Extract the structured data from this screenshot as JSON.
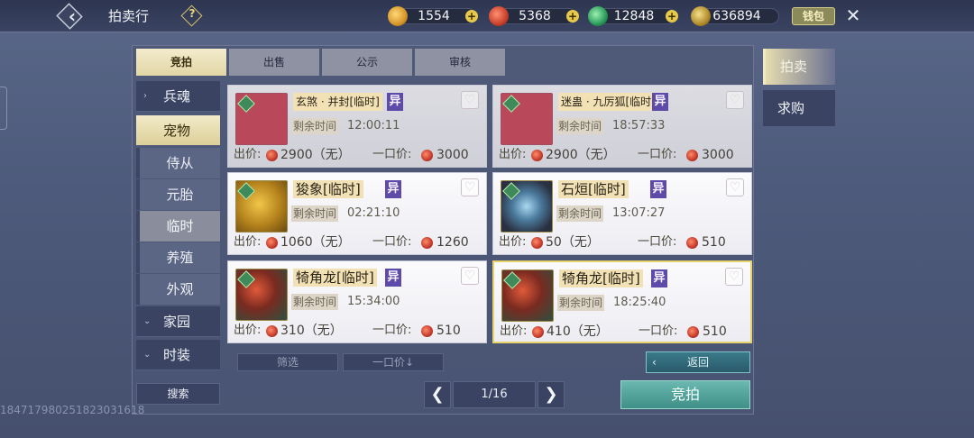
{
  "header": {
    "title": "拍卖行",
    "help_icon": "?",
    "wallet_label": "钱包",
    "currencies": [
      {
        "icon": "bell-gold-coin-icon",
        "value": "1554"
      },
      {
        "icon": "red-orb-coin-icon",
        "value": "5368"
      },
      {
        "icon": "jade-coin-icon",
        "value": "12848"
      },
      {
        "icon": "leaf-gold-coin-icon",
        "value": "636894"
      }
    ]
  },
  "tabs": [
    "竞拍",
    "出售",
    "公示",
    "审核"
  ],
  "categories": {
    "main": [
      "兵魂",
      "宠物",
      "家园",
      "时装"
    ],
    "sub": [
      "侍从",
      "元胎",
      "临时",
      "养殖",
      "外观"
    ]
  },
  "items": [
    {
      "name": "玄煞 · 并封[临时]",
      "tag": "异",
      "remaining_label": "剩余时间",
      "remaining": "12:00:11",
      "bid_label": "出价:",
      "bid": "2900（无）",
      "buy_label": "一口价:",
      "buy": "3000"
    },
    {
      "name": "迷蛊 · 九厉狐[临时]",
      "tag": "异",
      "remaining_label": "剩余时间",
      "remaining": "18:57:33",
      "bid_label": "出价:",
      "bid": "2900（无）",
      "buy_label": "一口价:",
      "buy": "3000"
    },
    {
      "name": "狻象[临时]",
      "tag": "异",
      "remaining_label": "剩余时间",
      "remaining": "02:21:10",
      "bid_label": "出价:",
      "bid": "1060（无）",
      "buy_label": "一口价:",
      "buy": "1260"
    },
    {
      "name": "石烜[临时]",
      "tag": "异",
      "remaining_label": "剩余时间",
      "remaining": "13:07:27",
      "bid_label": "出价:",
      "bid": "50（无）",
      "buy_label": "一口价:",
      "buy": "510"
    },
    {
      "name": "犄角龙[临时]",
      "tag": "异",
      "remaining_label": "剩余时间",
      "remaining": "15:34:00",
      "bid_label": "出价:",
      "bid": "310（无）",
      "buy_label": "一口价:",
      "buy": "510"
    },
    {
      "name": "犄角龙[临时]",
      "tag": "异",
      "remaining_label": "剩余时间",
      "remaining": "18:25:40",
      "bid_label": "出价:",
      "bid": "410（无）",
      "buy_label": "一口价:",
      "buy": "510"
    }
  ],
  "filters": {
    "filter_label": "筛选",
    "sort_label": "一口价↓",
    "return_label": "返回"
  },
  "search_label": "搜索",
  "pagination": {
    "prev": "❮",
    "next": "❯",
    "indicator": "1/16"
  },
  "bid_button_label": "竞拍",
  "side_menu": [
    "拍卖",
    "求购"
  ],
  "player_id": "184717980251823031618"
}
